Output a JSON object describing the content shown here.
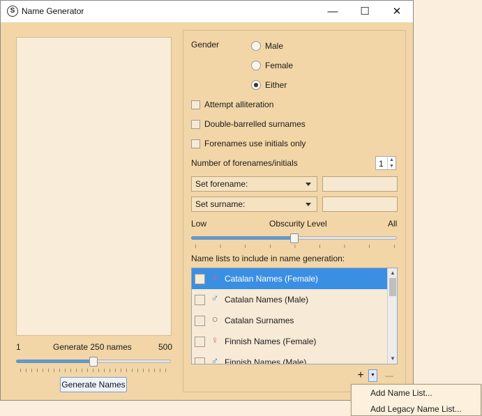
{
  "window": {
    "title": "Name Generator",
    "minimize": "—",
    "maximize": "☐",
    "close": "✕"
  },
  "left": {
    "slider_min": "1",
    "slider_label": "Generate 250 names",
    "slider_max": "500",
    "slider_value_fraction": 0.5,
    "generate_button": "Generate Names"
  },
  "right": {
    "gender_label": "Gender",
    "gender_options": [
      "Male",
      "Female",
      "Either"
    ],
    "gender_selected": "Either",
    "options": [
      "Attempt alliteration",
      "Double-barrelled surnames",
      "Forenames use initials only"
    ],
    "forenames_count_label": "Number of forenames/initials",
    "forenames_count": "1",
    "set_forename": "Set forename:",
    "set_surname": "Set surname:",
    "obscurity_low": "Low",
    "obscurity_label": "Obscurity Level",
    "obscurity_high": "All",
    "obscurity_value_fraction": 0.5,
    "name_lists_label": "Name lists to include in name generation:",
    "name_lists": [
      {
        "label": "Catalan Names (Female)",
        "gender": "female",
        "selected": true
      },
      {
        "label": "Catalan Names (Male)",
        "gender": "male",
        "selected": false
      },
      {
        "label": "Catalan Surnames",
        "gender": "neutral",
        "selected": false
      },
      {
        "label": "Finnish Names (Female)",
        "gender": "female",
        "selected": false
      },
      {
        "label": "Finnish Names (Male)",
        "gender": "male",
        "selected": false
      }
    ],
    "add_symbol": "+",
    "remove_symbol": "—"
  },
  "popup": {
    "items": [
      "Add Name List...",
      "Add Legacy Name List..."
    ]
  },
  "colors": {
    "female": "#e0607a",
    "male": "#3a8fd8",
    "neutral": "#666666",
    "selection": "#3b8fe3"
  }
}
